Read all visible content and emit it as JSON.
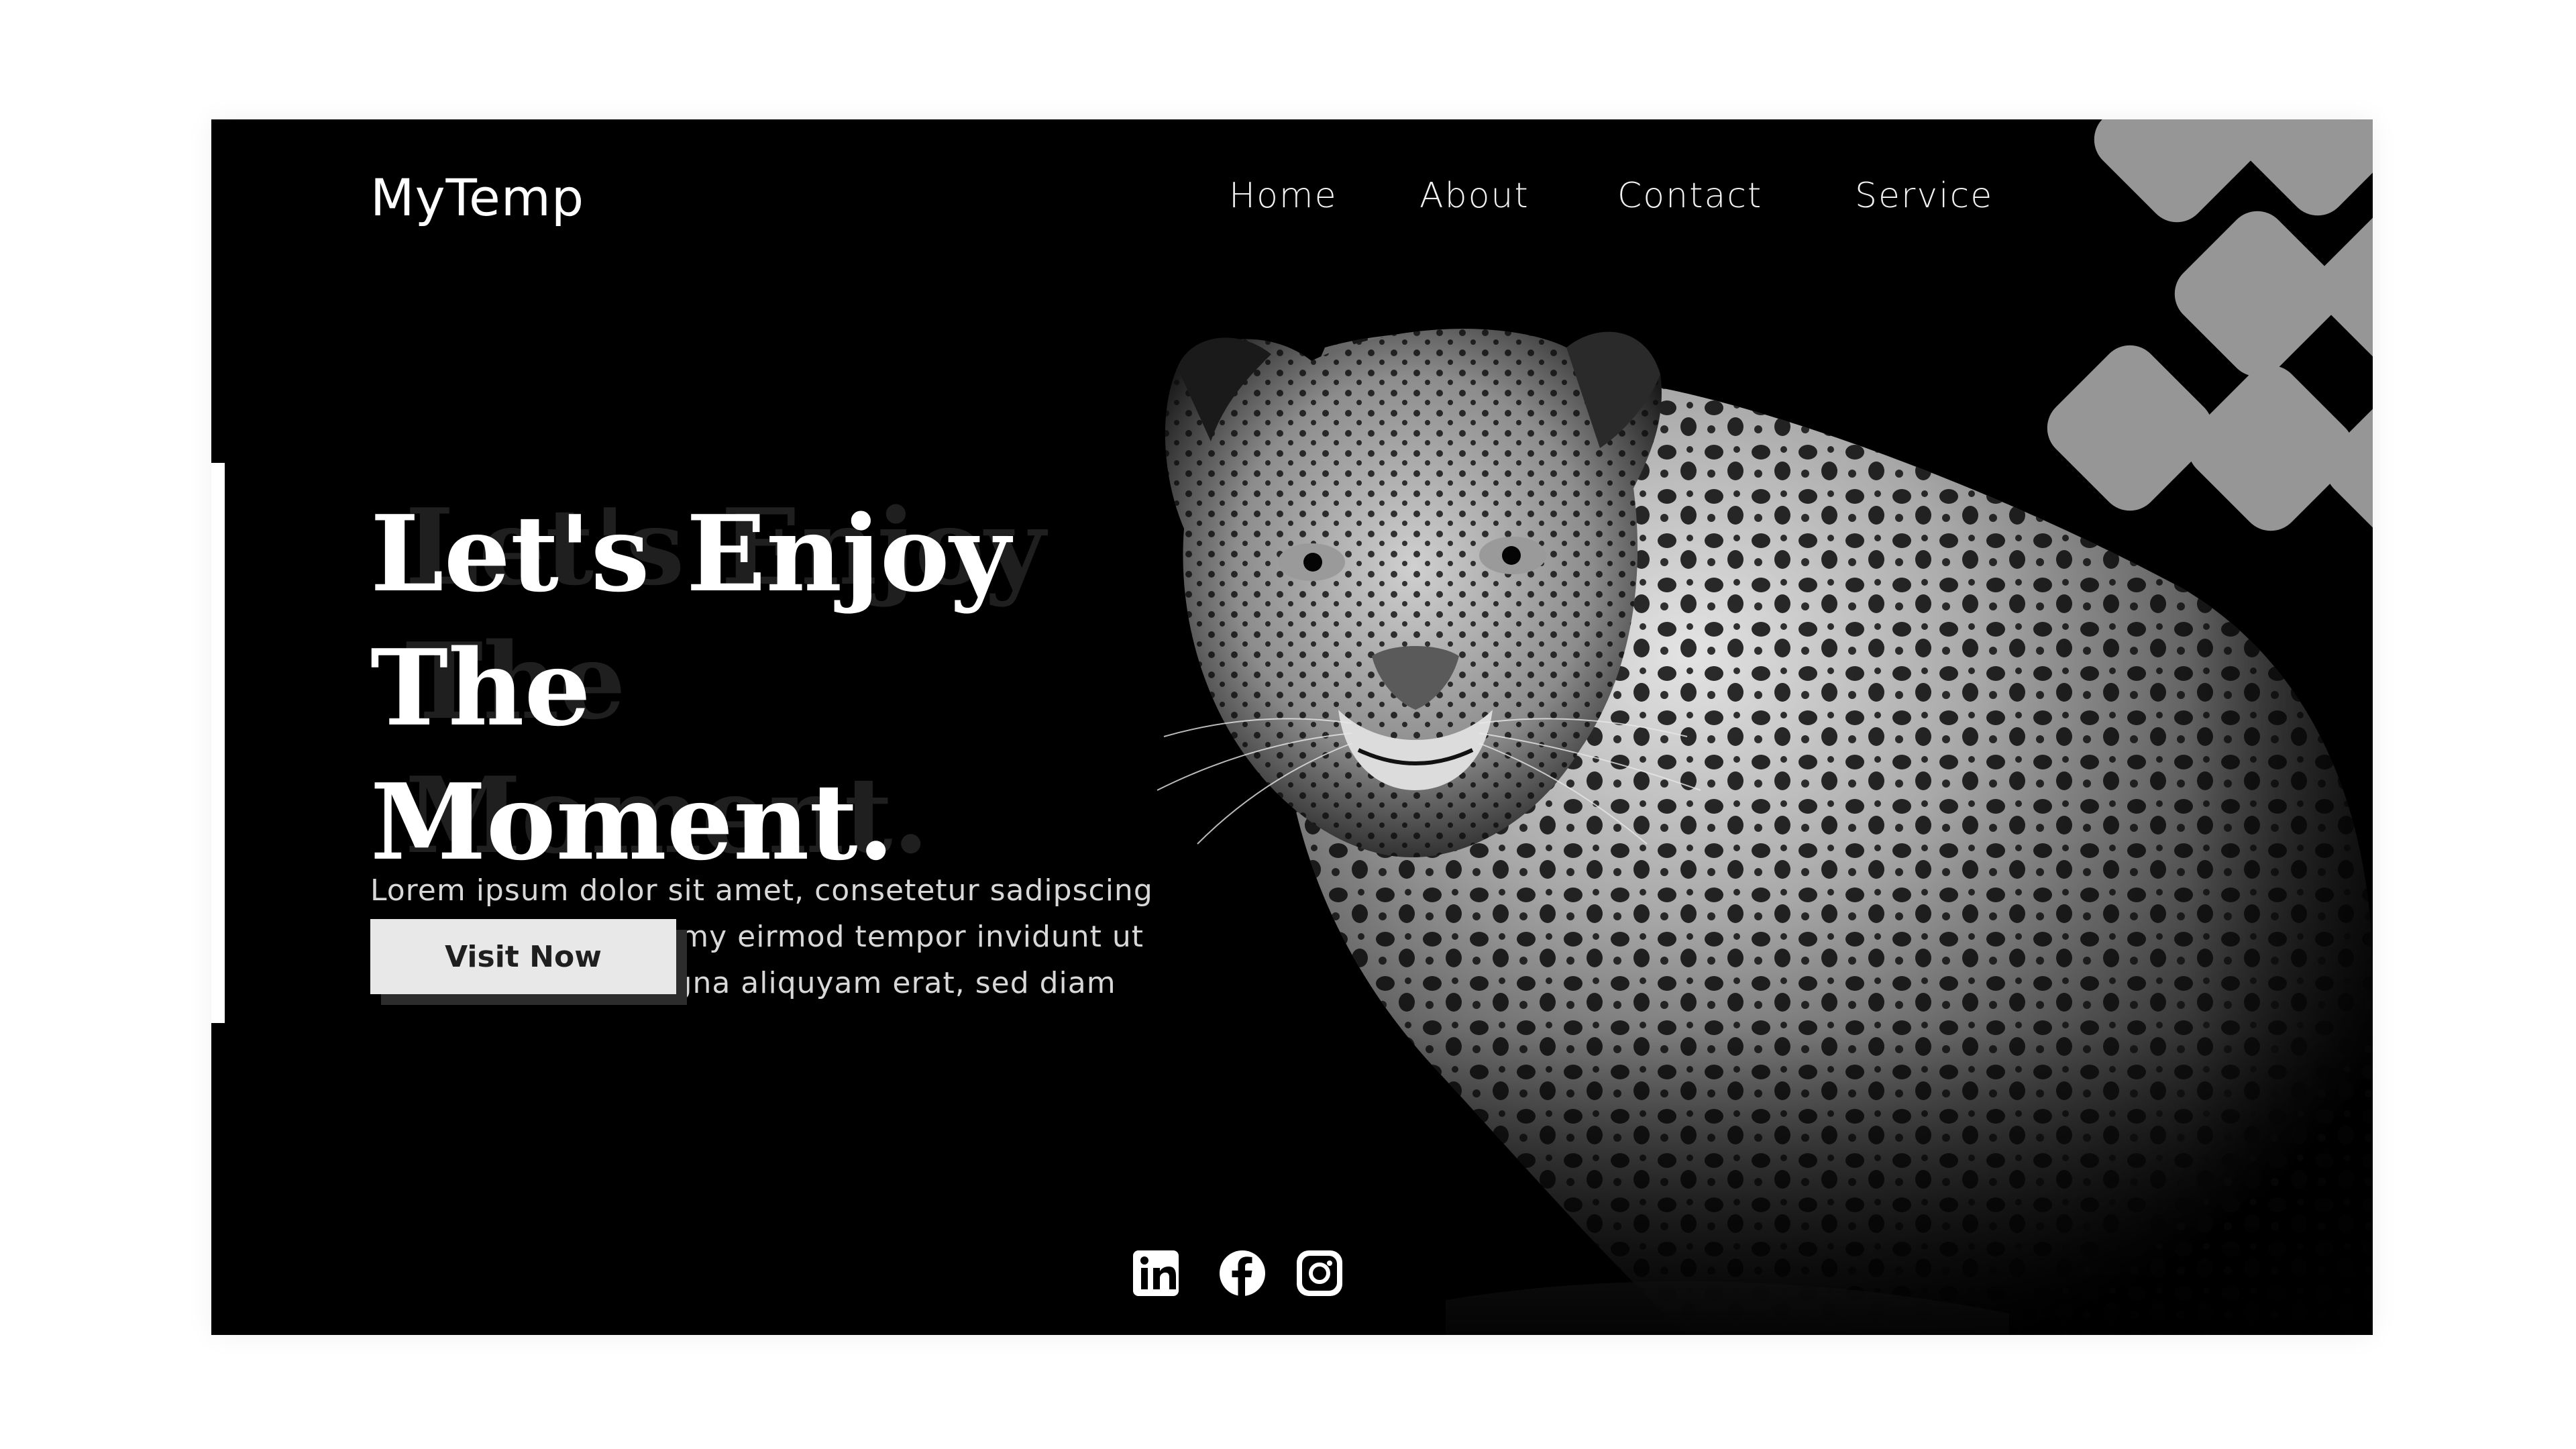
{
  "brand": {
    "logo": "MyTemp"
  },
  "nav": {
    "items": [
      {
        "label": "Home"
      },
      {
        "label": "About"
      },
      {
        "label": "Contact"
      },
      {
        "label": "Service"
      }
    ]
  },
  "hero": {
    "heading_line1": "Let's Enjoy The",
    "heading_line2": "Moment.",
    "description": "Lorem ipsum dolor sit amet, consetetur sadipscing elitr, sed diam nonumy eirmod tempor invidunt ut labore et dolore magna aliquyam erat, sed diam",
    "cta_label": "Visit Now"
  },
  "social": {
    "icons": [
      "linkedin-icon",
      "facebook-icon",
      "instagram-icon"
    ]
  },
  "colors": {
    "background": "#000000",
    "page": "#ffffff",
    "button": "#e8e8e8",
    "tiles": "#969696"
  }
}
